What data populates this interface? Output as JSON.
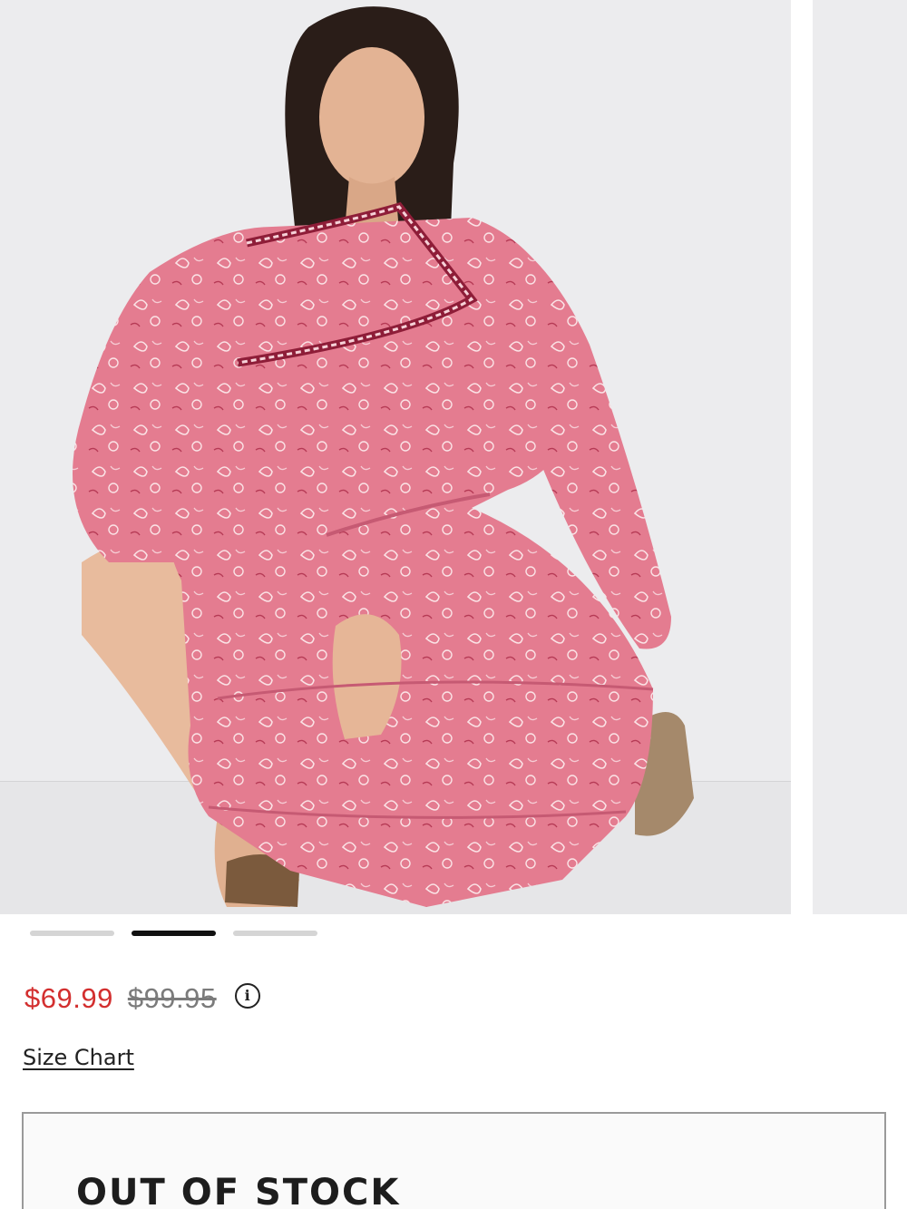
{
  "product": {
    "image_alt": "Woman in pink paisley print tiered mini dress with long sleeves",
    "carousel": {
      "slide_count": 3,
      "active_index": 1
    },
    "price": {
      "sale": "$69.99",
      "original": "$99.95",
      "info_icon": "info-circle-icon"
    },
    "size_chart_label": "Size Chart",
    "stock_status": "OUT OF STOCK"
  },
  "colors": {
    "sale_price": "#d32f2f",
    "original_price": "#7b7b7b",
    "dress": "#e07a8d",
    "dot_active": "#111111",
    "dot_inactive": "#d5d5d5"
  }
}
